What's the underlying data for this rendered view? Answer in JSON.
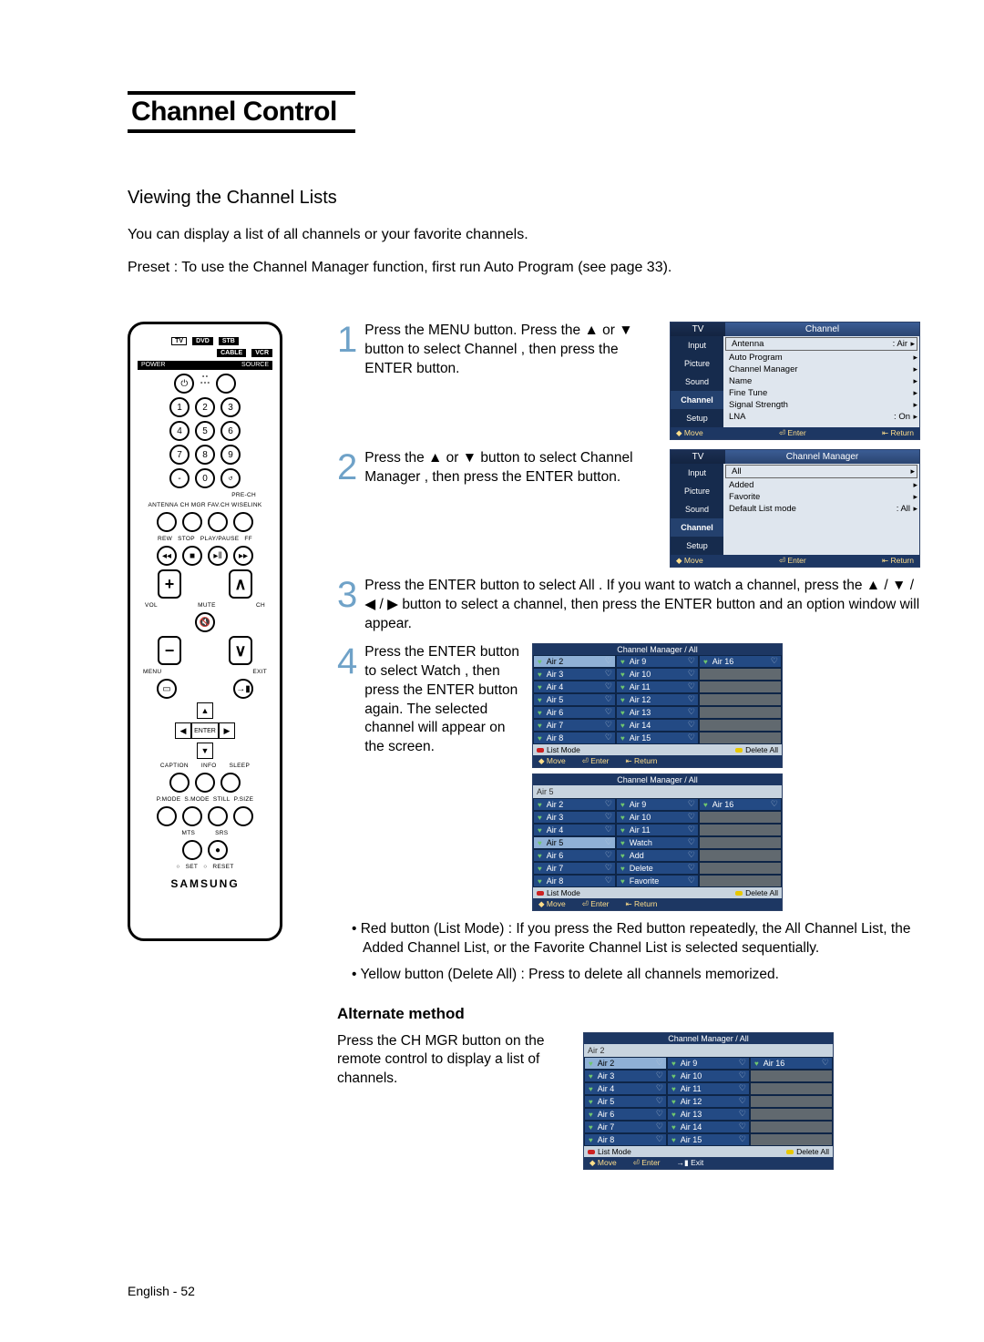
{
  "header": {
    "title": "Channel Control"
  },
  "intro": {
    "subtitle": "Viewing the Channel Lists",
    "p1": "You can display a list of all channels or your favorite channels.",
    "p2": "Preset : To use the Channel Manager function, first run Auto Program (see page 33)."
  },
  "remote": {
    "tv": "TV",
    "dvd": "DVD",
    "stb": "STB",
    "cable": "CABLE",
    "vcr": "VCR",
    "power": "POWER",
    "source": "SOURCE",
    "num": [
      "1",
      "2",
      "3",
      "4",
      "5",
      "6",
      "7",
      "8",
      "9",
      "0"
    ],
    "dash": "-",
    "prech": "PRE-CH",
    "row_small": [
      "ANTENNA",
      "CH MGR",
      "FAV.CH",
      "WISELINK"
    ],
    "trans": [
      "REW",
      "STOP",
      "PLAY/PAUSE",
      "FF"
    ],
    "vol": "VOL",
    "ch": "CH",
    "mute": "MUTE",
    "menu": "MENU",
    "exit": "EXIT",
    "enter": "ENTER",
    "caption": "CAPTION",
    "info": "INFO",
    "sleep": "SLEEP",
    "row_modes": [
      "P.MODE",
      "S.MODE",
      "STILL",
      "P.SIZE"
    ],
    "row_last": [
      "MTS",
      "SRS"
    ],
    "set": "SET",
    "reset": "RESET",
    "brand": "SAMSUNG"
  },
  "steps": {
    "s1": {
      "num": "1",
      "text": "Press the MENU button.\nPress the ▲ or ▼ button to select  Channel , then press the ENTER button."
    },
    "s2": {
      "num": "2",
      "text": "Press the ▲ or ▼ button to select  Channel Manager , then press the ENTER button."
    },
    "s3": {
      "num": "3",
      "text": "Press the ENTER button to select  All . If you want to watch a channel, press the ▲ / ▼ / ◀ / ▶ button to select a channel, then press the ENTER button and an option window will appear."
    },
    "s4": {
      "num": "4",
      "text": "Press the ENTER button to select  Watch , then press the ENTER button again.\nThe selected channel will appear on the screen.",
      "bullet1": "• Red button (List Mode) : If you press the Red button repeatedly, the All Channel List, the Added Channel List, or the Favorite Channel List is selected sequentially.",
      "bullet2": "• Yellow button (Delete All) : Press to delete all channels memorized."
    }
  },
  "osd1": {
    "tab_l": "TV",
    "tab_r": "Channel",
    "side": [
      "Input",
      "Picture",
      "Sound",
      "Channel",
      "Setup"
    ],
    "items": [
      {
        "l": "Antenna",
        "r": ": Air"
      },
      {
        "l": "Auto Program",
        "r": ""
      },
      {
        "l": "Channel Manager",
        "r": ""
      },
      {
        "l": "Name",
        "r": ""
      },
      {
        "l": "Fine Tune",
        "r": ""
      },
      {
        "l": "Signal Strength",
        "r": ""
      },
      {
        "l": "LNA",
        "r": ": On"
      }
    ],
    "foot": [
      "Move",
      "Enter",
      "Return"
    ]
  },
  "osd2": {
    "tab_l": "TV",
    "tab_r": "Channel Manager",
    "side": [
      "Input",
      "Picture",
      "Sound",
      "Channel",
      "Setup"
    ],
    "items": [
      {
        "l": "All",
        "r": ""
      },
      {
        "l": "Added",
        "r": ""
      },
      {
        "l": "Favorite",
        "r": ""
      },
      {
        "l": "Default List mode",
        "r": ": All"
      }
    ],
    "foot": [
      "Move",
      "Enter",
      "Return"
    ]
  },
  "chan1": {
    "head": "Channel Manager / All",
    "sub": "",
    "col1": [
      "Air 2",
      "Air 3",
      "Air 4",
      "Air 5",
      "Air 6",
      "Air 7",
      "Air 8"
    ],
    "col2": [
      "Air 9",
      "Air 10",
      "Air 11",
      "Air 12",
      "Air 13",
      "Air 14",
      "Air 15"
    ],
    "col3": [
      "Air 16",
      "",
      "",
      "",
      "",
      "",
      ""
    ],
    "list": "List Mode",
    "del": "Delete All",
    "nav": [
      "Move",
      "Enter",
      "Return"
    ]
  },
  "chan2": {
    "head": "Channel Manager / All",
    "sub": "Air 5",
    "col1": [
      "Air 2",
      "Air 3",
      "Air 4",
      "Air 5",
      "Air 6",
      "Air 7",
      "Air 8"
    ],
    "col2": [
      "Air 9",
      "Air 10",
      "Air 11",
      "Watch",
      "Add",
      "Delete",
      "Favorite"
    ],
    "col3": [
      "Air 16",
      "",
      "",
      "",
      "",
      "",
      ""
    ],
    "list": "List Mode",
    "del": "Delete All",
    "nav": [
      "Move",
      "Enter",
      "Return"
    ]
  },
  "alt": {
    "title": "Alternate method",
    "text": "Press the CH MGR button on the remote control to display a list of channels."
  },
  "chan3": {
    "head": "Channel Manager / All",
    "sub": "Air 2",
    "col1": [
      "Air 2",
      "Air 3",
      "Air 4",
      "Air 5",
      "Air 6",
      "Air 7",
      "Air 8"
    ],
    "col2": [
      "Air 9",
      "Air 10",
      "Air 11",
      "Air 12",
      "Air 13",
      "Air 14",
      "Air 15"
    ],
    "col3": [
      "Air 16",
      "",
      "",
      "",
      "",
      "",
      ""
    ],
    "list": "List Mode",
    "del": "Delete All",
    "nav": [
      "Move",
      "Enter",
      "Exit"
    ]
  },
  "footer": "English - 52"
}
